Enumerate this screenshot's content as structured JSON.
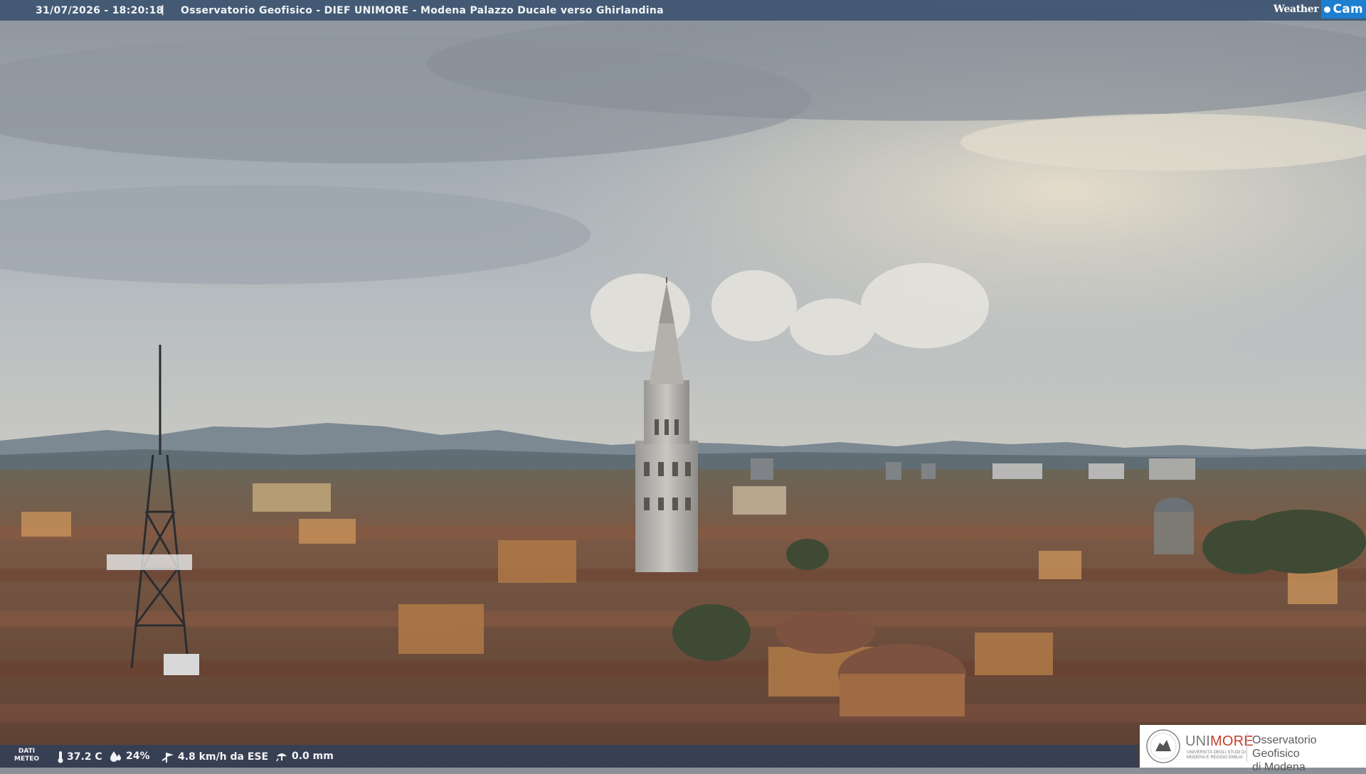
{
  "overlay": {
    "datetime": "31/07/2026 - 18:20:18",
    "separator": "|",
    "caption": "Osservatorio Geofisico - DIEF UNIMORE - Modena Palazzo Ducale verso Ghirlandina",
    "brand_weather": "Weather",
    "brand_cam": "Cam"
  },
  "meteo": {
    "label_line1": "DATI",
    "label_line2": "METEO",
    "temperature": "37.2 C",
    "humidity": "24%",
    "wind": "4.8 km/h da ESE",
    "rain": "0.0 mm",
    "icons": [
      "thermometer-icon",
      "humidity-icon",
      "wind-icon",
      "rain-gauge-icon"
    ]
  },
  "logo": {
    "uni": "UNI",
    "more": "MORE",
    "sub_line1": "UNIVERSITÀ DEGLI STUDI DI",
    "sub_line2": "MODENA E REGGIO EMILIA",
    "observatory_line1": "Osservatorio Geofisico",
    "observatory_line2": "di Modena"
  },
  "colors": {
    "accent_blue": "#1c7fd0",
    "overlay_bar": "#3a526e",
    "unimore_red": "#c8402a"
  }
}
